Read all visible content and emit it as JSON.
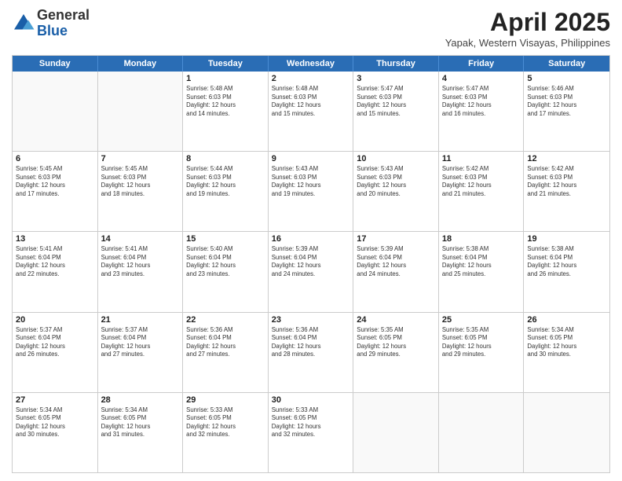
{
  "logo": {
    "general": "General",
    "blue": "Blue"
  },
  "title": "April 2025",
  "location": "Yapak, Western Visayas, Philippines",
  "weekdays": [
    "Sunday",
    "Monday",
    "Tuesday",
    "Wednesday",
    "Thursday",
    "Friday",
    "Saturday"
  ],
  "weeks": [
    [
      {
        "day": "",
        "info": ""
      },
      {
        "day": "",
        "info": ""
      },
      {
        "day": "1",
        "info": "Sunrise: 5:48 AM\nSunset: 6:03 PM\nDaylight: 12 hours\nand 14 minutes."
      },
      {
        "day": "2",
        "info": "Sunrise: 5:48 AM\nSunset: 6:03 PM\nDaylight: 12 hours\nand 15 minutes."
      },
      {
        "day": "3",
        "info": "Sunrise: 5:47 AM\nSunset: 6:03 PM\nDaylight: 12 hours\nand 15 minutes."
      },
      {
        "day": "4",
        "info": "Sunrise: 5:47 AM\nSunset: 6:03 PM\nDaylight: 12 hours\nand 16 minutes."
      },
      {
        "day": "5",
        "info": "Sunrise: 5:46 AM\nSunset: 6:03 PM\nDaylight: 12 hours\nand 17 minutes."
      }
    ],
    [
      {
        "day": "6",
        "info": "Sunrise: 5:45 AM\nSunset: 6:03 PM\nDaylight: 12 hours\nand 17 minutes."
      },
      {
        "day": "7",
        "info": "Sunrise: 5:45 AM\nSunset: 6:03 PM\nDaylight: 12 hours\nand 18 minutes."
      },
      {
        "day": "8",
        "info": "Sunrise: 5:44 AM\nSunset: 6:03 PM\nDaylight: 12 hours\nand 19 minutes."
      },
      {
        "day": "9",
        "info": "Sunrise: 5:43 AM\nSunset: 6:03 PM\nDaylight: 12 hours\nand 19 minutes."
      },
      {
        "day": "10",
        "info": "Sunrise: 5:43 AM\nSunset: 6:03 PM\nDaylight: 12 hours\nand 20 minutes."
      },
      {
        "day": "11",
        "info": "Sunrise: 5:42 AM\nSunset: 6:03 PM\nDaylight: 12 hours\nand 21 minutes."
      },
      {
        "day": "12",
        "info": "Sunrise: 5:42 AM\nSunset: 6:03 PM\nDaylight: 12 hours\nand 21 minutes."
      }
    ],
    [
      {
        "day": "13",
        "info": "Sunrise: 5:41 AM\nSunset: 6:04 PM\nDaylight: 12 hours\nand 22 minutes."
      },
      {
        "day": "14",
        "info": "Sunrise: 5:41 AM\nSunset: 6:04 PM\nDaylight: 12 hours\nand 23 minutes."
      },
      {
        "day": "15",
        "info": "Sunrise: 5:40 AM\nSunset: 6:04 PM\nDaylight: 12 hours\nand 23 minutes."
      },
      {
        "day": "16",
        "info": "Sunrise: 5:39 AM\nSunset: 6:04 PM\nDaylight: 12 hours\nand 24 minutes."
      },
      {
        "day": "17",
        "info": "Sunrise: 5:39 AM\nSunset: 6:04 PM\nDaylight: 12 hours\nand 24 minutes."
      },
      {
        "day": "18",
        "info": "Sunrise: 5:38 AM\nSunset: 6:04 PM\nDaylight: 12 hours\nand 25 minutes."
      },
      {
        "day": "19",
        "info": "Sunrise: 5:38 AM\nSunset: 6:04 PM\nDaylight: 12 hours\nand 26 minutes."
      }
    ],
    [
      {
        "day": "20",
        "info": "Sunrise: 5:37 AM\nSunset: 6:04 PM\nDaylight: 12 hours\nand 26 minutes."
      },
      {
        "day": "21",
        "info": "Sunrise: 5:37 AM\nSunset: 6:04 PM\nDaylight: 12 hours\nand 27 minutes."
      },
      {
        "day": "22",
        "info": "Sunrise: 5:36 AM\nSunset: 6:04 PM\nDaylight: 12 hours\nand 27 minutes."
      },
      {
        "day": "23",
        "info": "Sunrise: 5:36 AM\nSunset: 6:04 PM\nDaylight: 12 hours\nand 28 minutes."
      },
      {
        "day": "24",
        "info": "Sunrise: 5:35 AM\nSunset: 6:05 PM\nDaylight: 12 hours\nand 29 minutes."
      },
      {
        "day": "25",
        "info": "Sunrise: 5:35 AM\nSunset: 6:05 PM\nDaylight: 12 hours\nand 29 minutes."
      },
      {
        "day": "26",
        "info": "Sunrise: 5:34 AM\nSunset: 6:05 PM\nDaylight: 12 hours\nand 30 minutes."
      }
    ],
    [
      {
        "day": "27",
        "info": "Sunrise: 5:34 AM\nSunset: 6:05 PM\nDaylight: 12 hours\nand 30 minutes."
      },
      {
        "day": "28",
        "info": "Sunrise: 5:34 AM\nSunset: 6:05 PM\nDaylight: 12 hours\nand 31 minutes."
      },
      {
        "day": "29",
        "info": "Sunrise: 5:33 AM\nSunset: 6:05 PM\nDaylight: 12 hours\nand 32 minutes."
      },
      {
        "day": "30",
        "info": "Sunrise: 5:33 AM\nSunset: 6:05 PM\nDaylight: 12 hours\nand 32 minutes."
      },
      {
        "day": "",
        "info": ""
      },
      {
        "day": "",
        "info": ""
      },
      {
        "day": "",
        "info": ""
      }
    ]
  ]
}
